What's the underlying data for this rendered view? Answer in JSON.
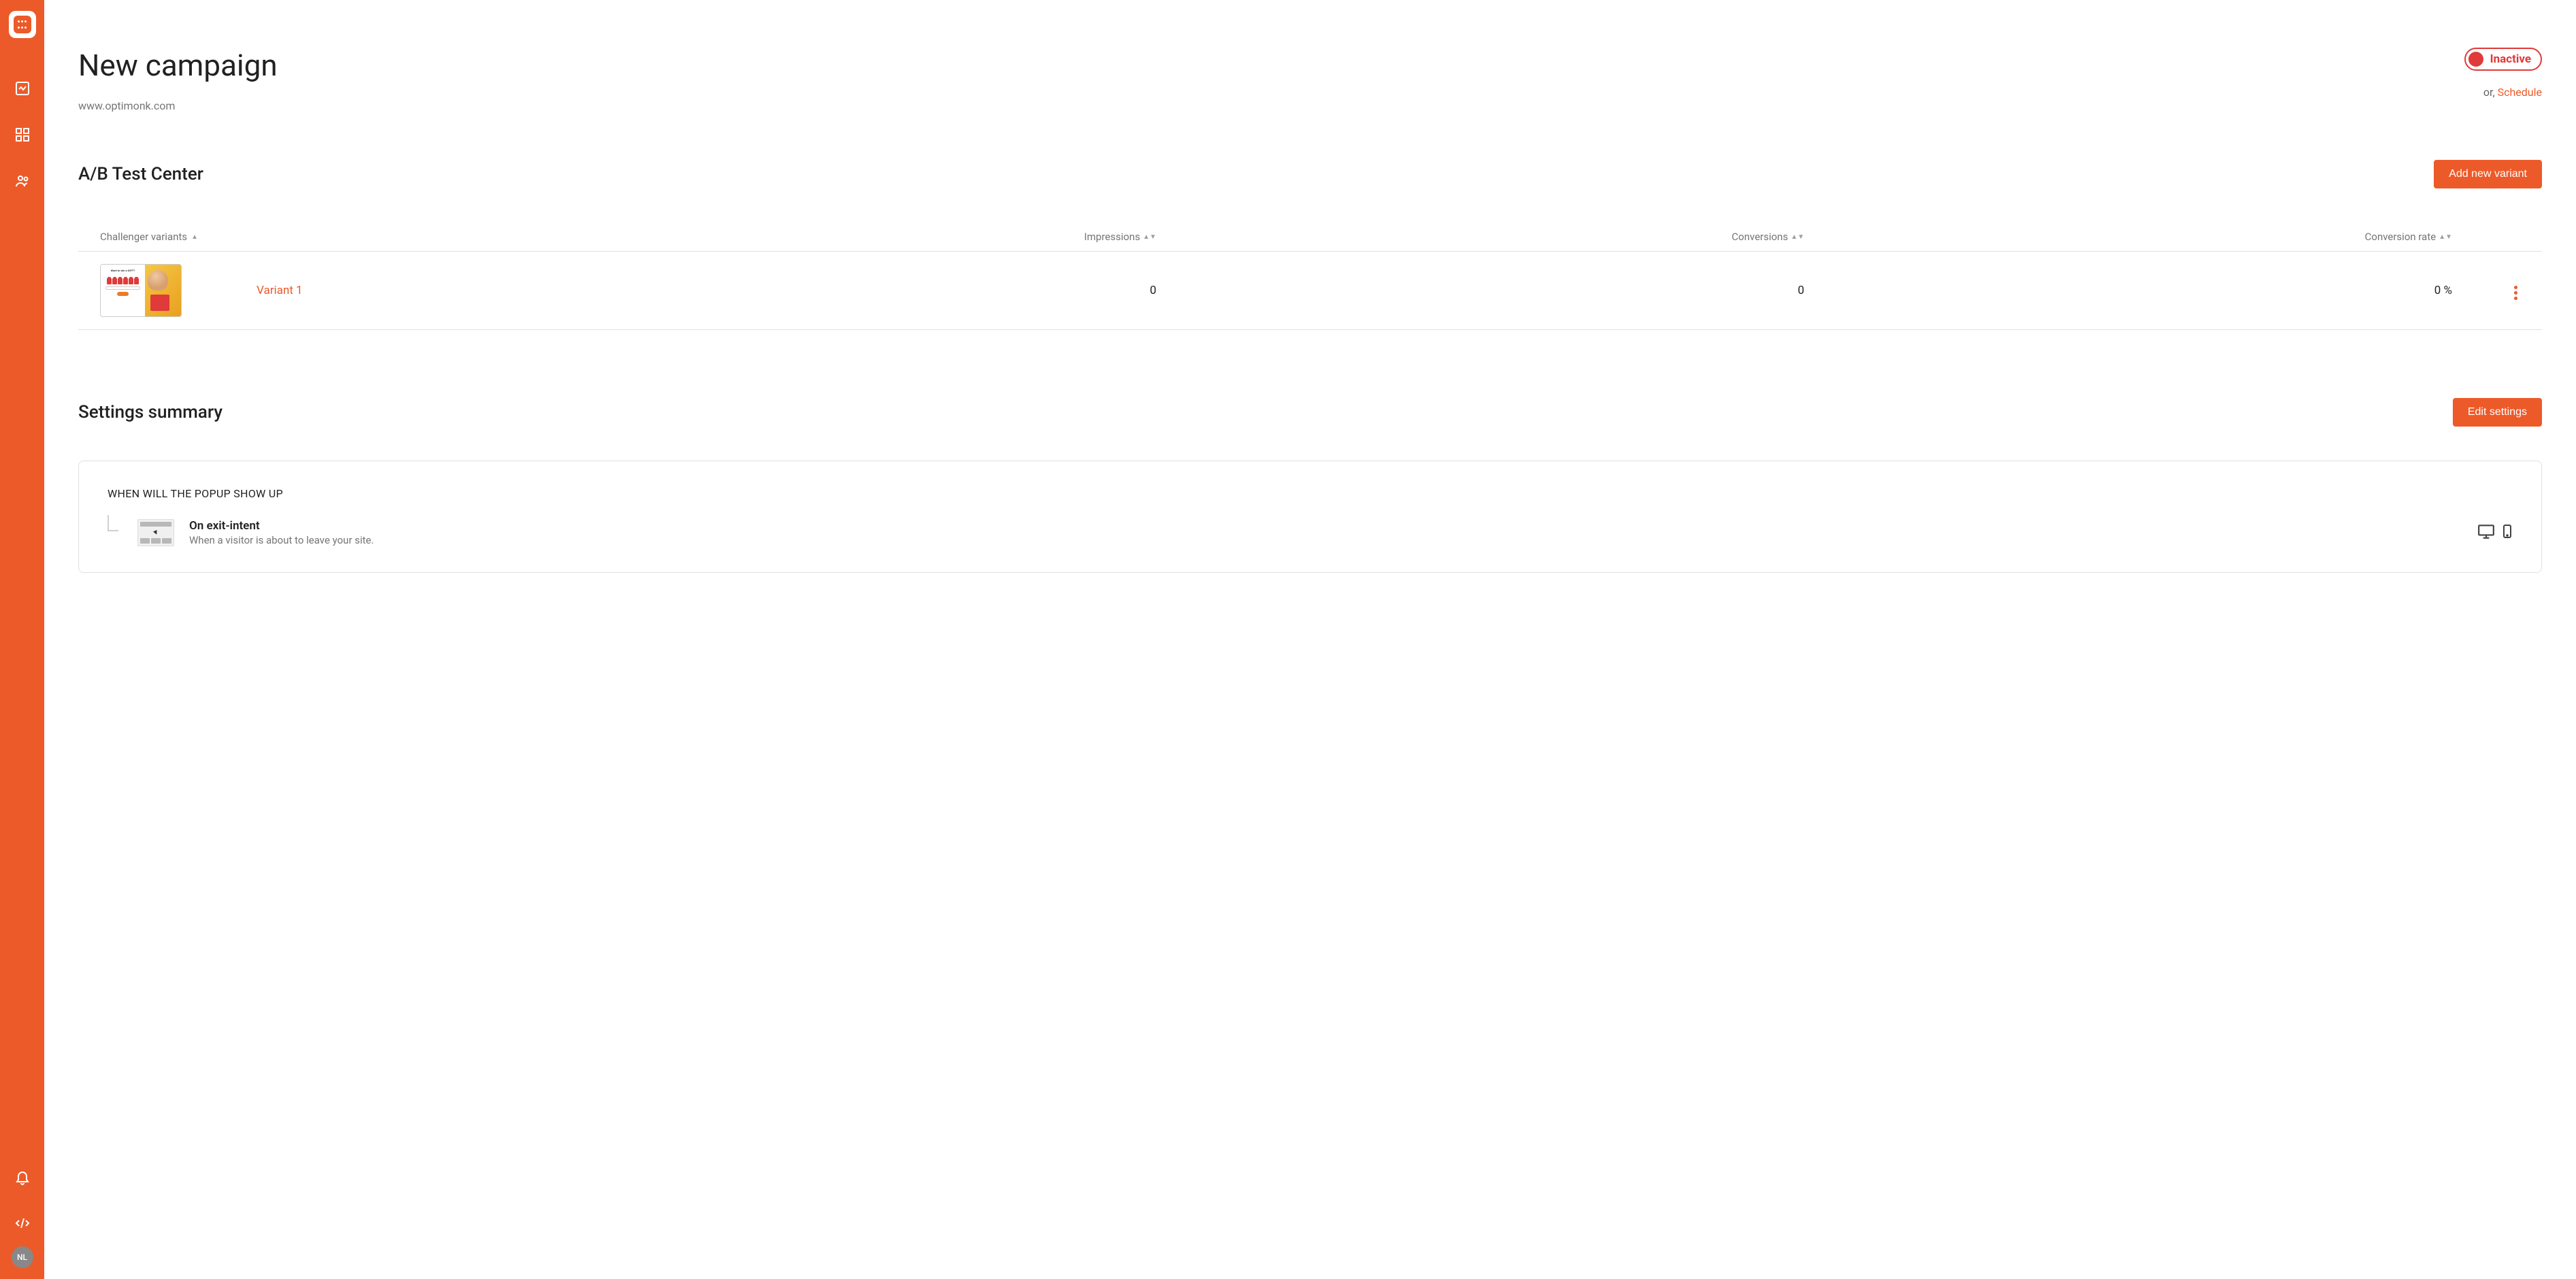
{
  "sidebar": {
    "avatar_initials": "NL"
  },
  "header": {
    "title": "New campaign",
    "domain": "www.optimonk.com",
    "status_label": "Inactive",
    "or_text": "or, ",
    "schedule_link": "Schedule"
  },
  "abtest": {
    "section_title": "A/B Test Center",
    "add_button": "Add new variant",
    "columns": {
      "variants": "Challenger variants",
      "impressions": "Impressions",
      "conversions": "Conversions",
      "rate": "Conversion rate"
    },
    "rows": [
      {
        "name": "Variant 1",
        "impressions": "0",
        "conversions": "0",
        "rate": "0 %",
        "thumb_title": "Want to win a GIFT?"
      }
    ]
  },
  "settings": {
    "section_title": "Settings summary",
    "edit_button": "Edit settings",
    "when_heading": "WHEN WILL THE POPUP SHOW UP",
    "trigger_title": "On exit-intent",
    "trigger_desc": "When a visitor is about to leave your site."
  }
}
